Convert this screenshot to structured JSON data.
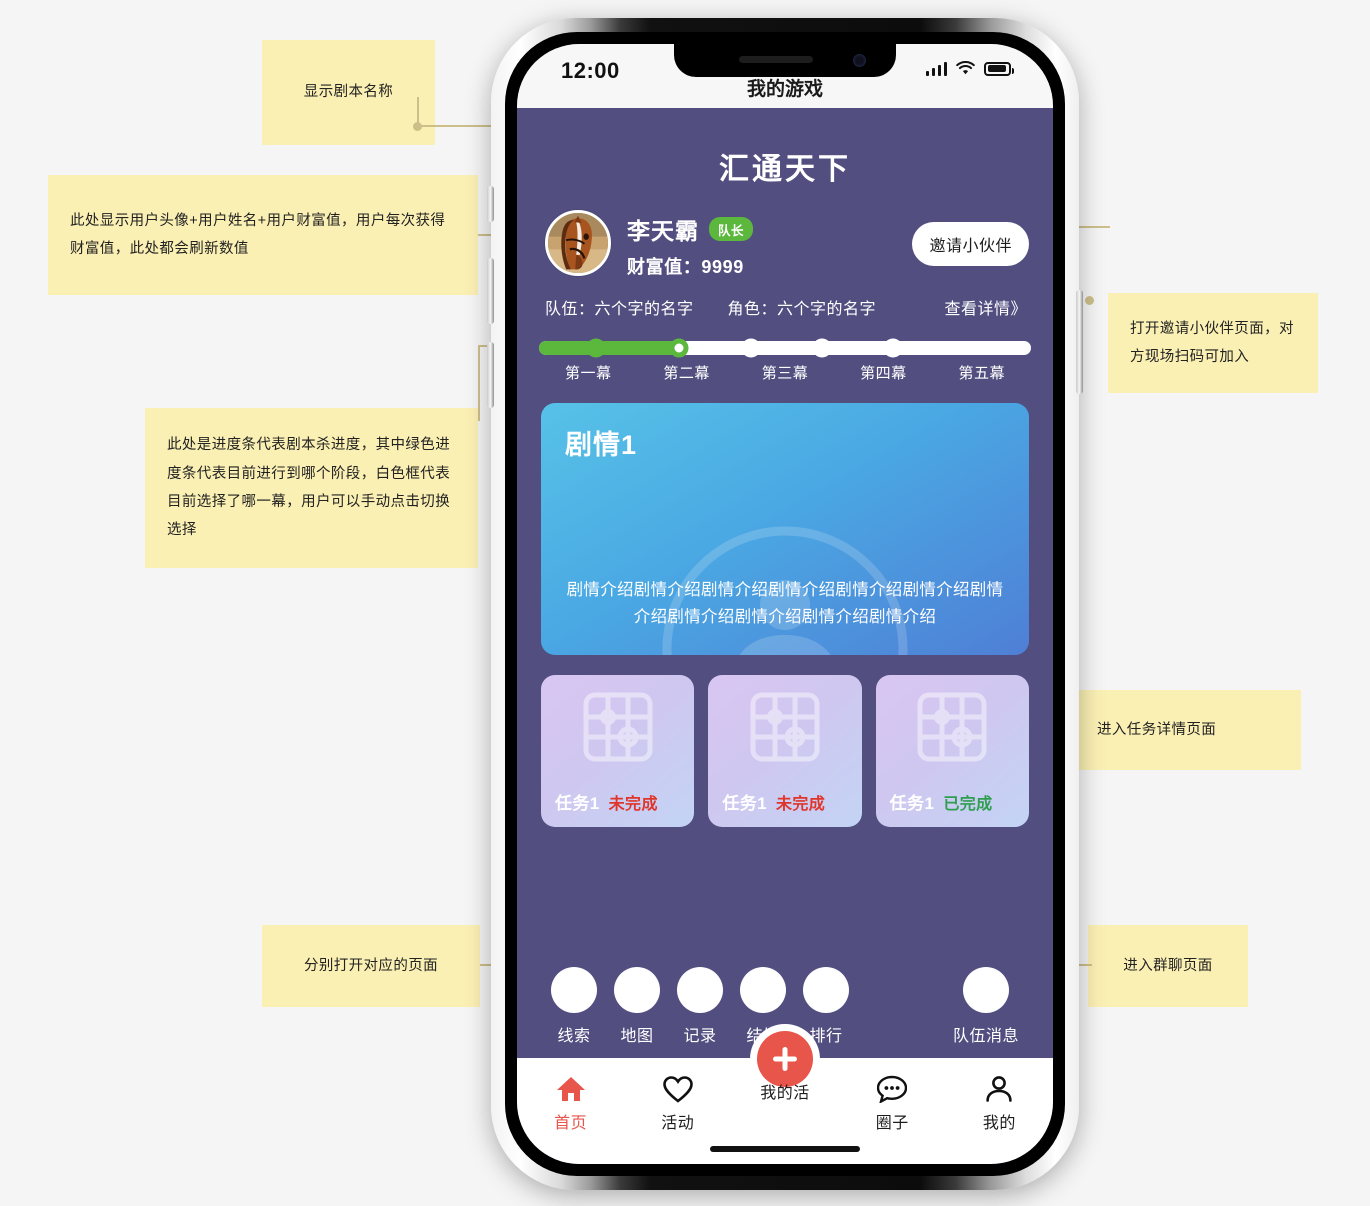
{
  "phone": {
    "statusbar": {
      "time": "12:00",
      "signal_icon": "signal-bars-icon",
      "wifi_icon": "wifi-icon",
      "battery_icon": "battery-icon"
    },
    "nav_title": "我的游戏"
  },
  "app": {
    "script_title": "汇通天下",
    "theme": {
      "background": "#524f80",
      "accent_green": "#5bb83c",
      "accent_red": "#e8554b",
      "card_blue": "#4aa8e3"
    },
    "profile": {
      "avatar_icon": "horse-avatar",
      "name": "李天霸",
      "role_badge": "队长",
      "wealth_label": "财富值：",
      "wealth_value": "9999",
      "invite_button": "邀请小伙伴"
    },
    "meta": {
      "team_label": "队伍：",
      "team_value": "六个字的名字",
      "role_label": "角色：",
      "role_value": "六个字的名字",
      "detail_link": "查看详情》"
    },
    "progress": {
      "fill_percent": 28.5,
      "current_index": 1,
      "acts": [
        {
          "label": "第一幕",
          "state": "done"
        },
        {
          "label": "第二幕",
          "state": "current"
        },
        {
          "label": "第三幕",
          "state": "todo"
        },
        {
          "label": "第四幕",
          "state": "todo"
        },
        {
          "label": "第五幕",
          "state": "todo"
        }
      ]
    },
    "story": {
      "title": "剧情1",
      "description": "剧情介绍剧情介绍剧情介绍剧情介绍剧情介绍剧情介绍剧情介绍剧情介绍剧情介绍剧情介绍剧情介绍"
    },
    "tasks": [
      {
        "name": "任务1",
        "status": "未完成",
        "status_state": "undone",
        "icon": "grid-placeholder-icon"
      },
      {
        "name": "任务1",
        "status": "未完成",
        "status_state": "undone",
        "icon": "grid-placeholder-icon"
      },
      {
        "name": "任务1",
        "status": "已完成",
        "status_state": "done",
        "icon": "grid-placeholder-icon"
      }
    ],
    "actions": [
      {
        "label": "线索"
      },
      {
        "label": "地图"
      },
      {
        "label": "记录"
      },
      {
        "label": "结婚"
      },
      {
        "label": "排行"
      }
    ],
    "action_right": {
      "label": "队伍消息"
    },
    "tabbar": [
      {
        "label": "首页",
        "icon": "home-icon",
        "active": true
      },
      {
        "label": "活动",
        "icon": "heart-icon",
        "active": false
      },
      {
        "label": "我的活",
        "icon": "plus-circle-icon",
        "active": false
      },
      {
        "label": "圈子",
        "icon": "chat-bubble-icon",
        "active": false
      },
      {
        "label": "我的",
        "icon": "person-icon",
        "active": false
      }
    ]
  },
  "annotations": [
    {
      "id": "a1",
      "text": "显示剧本名称"
    },
    {
      "id": "a2",
      "text": "此处显示用户头像+用户姓名+用户财富值，用户每次获得财富值，此处都会刷新数值"
    },
    {
      "id": "a3",
      "text": "此处是进度条代表剧本杀进度，其中绿色进度条代表目前进行到哪个阶段，白色框代表目前选择了哪一幕，用户可以手动点击切换选择"
    },
    {
      "id": "a4",
      "text": "打开邀请小伙伴页面，对方现场扫码可加入"
    },
    {
      "id": "a5",
      "text": "进入任务详情页面"
    },
    {
      "id": "a6",
      "text": "分别打开对应的页面"
    },
    {
      "id": "a7",
      "text": "进入群聊页面"
    }
  ]
}
